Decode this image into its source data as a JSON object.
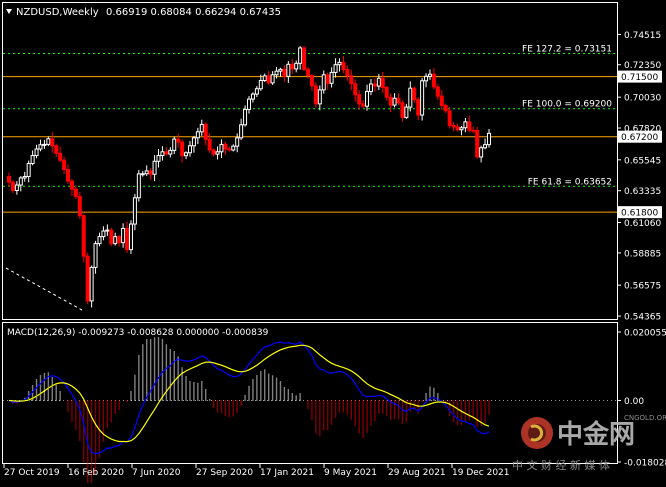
{
  "header": {
    "symbol": "NZDUSD,Weekly",
    "ohlc": "0.66919 0.68084 0.66294 0.67435"
  },
  "price_axis_labels": [
    "0.74515",
    "0.72350",
    "0.70030",
    "0.67820",
    "0.65545",
    "0.63335",
    "0.61060",
    "0.58885",
    "0.56575",
    "0.54365"
  ],
  "price_tags": [
    {
      "text": "0.71500",
      "value": 0.715
    },
    {
      "text": "0.67200",
      "value": 0.672
    },
    {
      "text": "0.61800",
      "value": 0.618
    }
  ],
  "fib_levels": [
    {
      "label": "FE 127.2 = 0.73151",
      "value": 0.73151
    },
    {
      "label": "FE 100.0 = 0.69200",
      "value": 0.692
    },
    {
      "label": "FE 61.8 = 0.63652",
      "value": 0.63652
    }
  ],
  "macd": {
    "label": "MACD(12,26,9) -0.009273 -0.008628 0.000000 -0.000839",
    "axis_labels": [
      "0.020055",
      "0.00",
      "-0.018028"
    ]
  },
  "time_labels": [
    "27 Oct 2019",
    "16 Feb 2020",
    "7 Jun 2020",
    "27 Sep 2020",
    "17 Jan 2021",
    "9 May 2021",
    "29 Aug 2021",
    "19 Dec 2021"
  ],
  "watermark": {
    "brand": "中金网",
    "domain": "CNGOLD.ORG",
    "slogan": "中 文 财 经 新 媒 体"
  },
  "colors": {
    "background": "#000000",
    "bull": "#ffffff",
    "bear": "#ff0000",
    "level_line": "#ffa500",
    "fib_line": "#00ff00",
    "macd_signal": "#ffff00",
    "macd_main": "#0000ff",
    "macd_hist_pos": "#ffffff",
    "macd_hist_neg": "#ff0000",
    "grid": "#ffffff"
  },
  "chart_data": {
    "type": "candlestick",
    "title": "NZDUSD,Weekly",
    "ylim": [
      0.5437,
      0.7555
    ],
    "closes": [
      0.6395,
      0.6335,
      0.6374,
      0.6425,
      0.6435,
      0.6528,
      0.6585,
      0.6632,
      0.6662,
      0.6665,
      0.6705,
      0.6655,
      0.6601,
      0.6552,
      0.6485,
      0.6402,
      0.6345,
      0.6293,
      0.6155,
      0.5865,
      0.5545,
      0.5785,
      0.5955,
      0.6005,
      0.6045,
      0.6052,
      0.5955,
      0.6005,
      0.5962,
      0.6063,
      0.5912,
      0.6095,
      0.6283,
      0.6454,
      0.6455,
      0.6475,
      0.6451,
      0.6544,
      0.6585,
      0.6612,
      0.6596,
      0.6622,
      0.6703,
      0.6682,
      0.6584,
      0.6605,
      0.6655,
      0.6712,
      0.6755,
      0.6808,
      0.6701,
      0.6625,
      0.6595,
      0.6612,
      0.6665,
      0.6632,
      0.6625,
      0.6652,
      0.6712,
      0.6805,
      0.6915,
      0.6989,
      0.7025,
      0.7063,
      0.7122,
      0.7155,
      0.7105,
      0.7163,
      0.7189,
      0.7202,
      0.7152,
      0.7238,
      0.7205,
      0.7245,
      0.7355,
      0.7202,
      0.7158,
      0.7083,
      0.6955,
      0.7055,
      0.7163,
      0.7102,
      0.718,
      0.7235,
      0.7252,
      0.72,
      0.7157,
      0.7099,
      0.702,
      0.6955,
      0.6938,
      0.7043,
      0.7097,
      0.7082,
      0.7138,
      0.7072,
      0.7002,
      0.6946,
      0.6995,
      0.6962,
      0.6858,
      0.6932,
      0.7067,
      0.6985,
      0.6875,
      0.712,
      0.7152,
      0.7167,
      0.7076,
      0.701,
      0.6943,
      0.6906,
      0.68,
      0.679,
      0.677,
      0.6784,
      0.6826,
      0.6766,
      0.6764,
      0.6575,
      0.6641,
      0.6663,
      0.6744
    ]
  }
}
